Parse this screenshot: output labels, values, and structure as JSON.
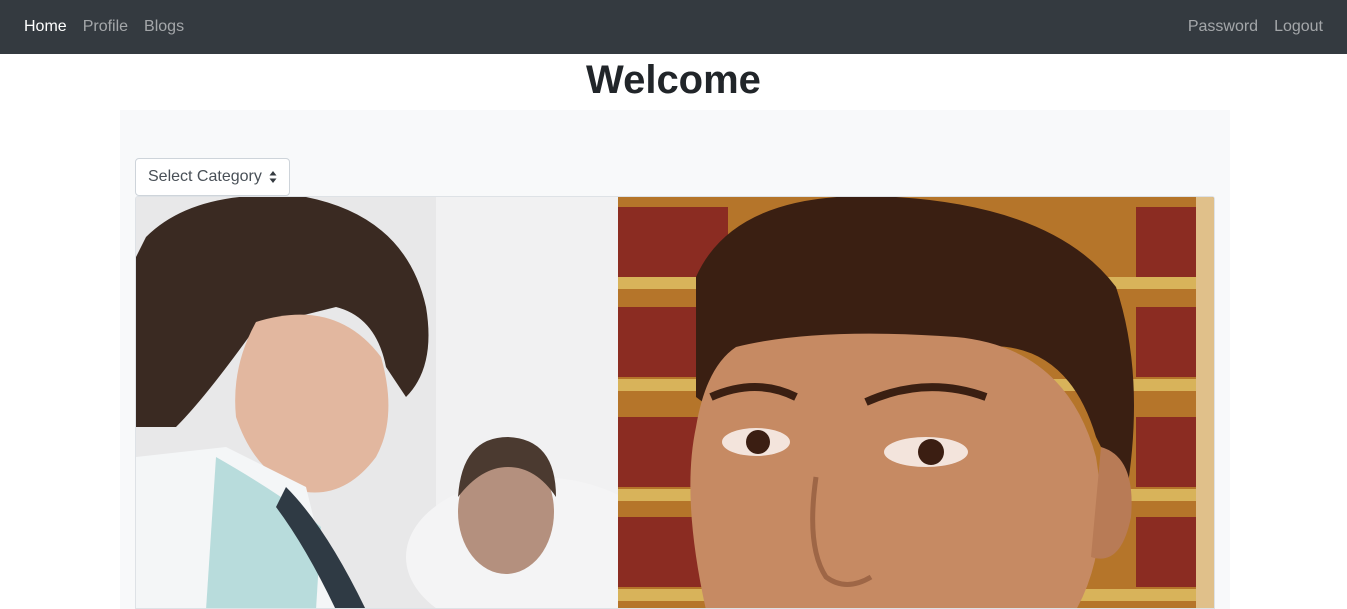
{
  "nav": {
    "left": [
      {
        "label": "Home",
        "active": true
      },
      {
        "label": "Profile",
        "active": false
      },
      {
        "label": "Blogs",
        "active": false
      }
    ],
    "right": [
      {
        "label": "Password"
      },
      {
        "label": "Logout"
      }
    ]
  },
  "page": {
    "title": "Welcome"
  },
  "filter": {
    "selected": "Select Category",
    "icon": "sort-arrows-icon"
  },
  "hero": {
    "description_icon": "hero-image",
    "colors": {
      "navbar": "#343a40",
      "panel": "#f8f9fa",
      "bookshelf": "#b5752a"
    }
  }
}
